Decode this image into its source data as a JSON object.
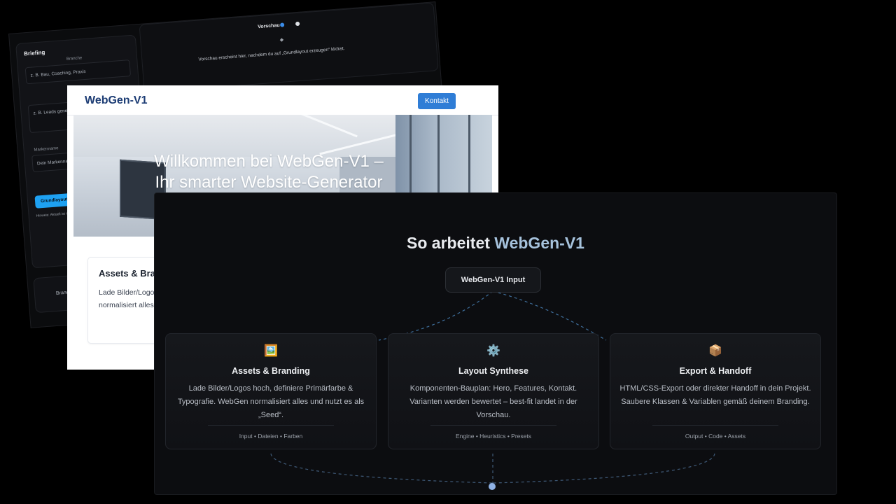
{
  "editor": {
    "briefing_title": "Briefing",
    "branche_label": "Branche",
    "branche_placeholder": "z. B. Bau, Coaching, Praxis",
    "goal_placeholder": "z. B. Leads generieren",
    "brand_label": "Markenname",
    "brand_placeholder": "Dein Markenname",
    "generate_button": "Grundlayout erz",
    "hint_text": "Hinweis: Aktuell ist m… wird funktionieren …",
    "branche_card": "Branche,",
    "preview_title": "Vorschau",
    "preview_text": "Vorschau erscheint hier, nachdem du auf „Grundlayout erzeugen“ klickst."
  },
  "site": {
    "logo": "WebGen-V1",
    "contact_button": "Kontakt",
    "hero_line1": "Willkommen bei WebGen-V1 –",
    "hero_line2": "Ihr smarter Website-Generator",
    "card_title": "Assets & Bran",
    "card_text": "Lade Bilder/Logos definiere Primarfa Typografie, WebG normalisiert alles"
  },
  "workflow": {
    "title_prefix": "So arbeitet ",
    "title_accent": "WebGen-V1",
    "input_label": "WebGen-V1 Input",
    "cards": [
      {
        "icon": "🖼️",
        "icon_name": "image-icon",
        "title": "Assets & Branding",
        "description": "Lade Bilder/Logos hoch, definiere Primärfarbe & Typografie. WebGen normalisiert alles und nutzt es als „Seed“.",
        "tags": "Input • Dateien • Farben"
      },
      {
        "icon": "⚙️",
        "icon_name": "gear-icon",
        "title": "Layout Synthese",
        "description": "Komponenten-Bauplan: Hero, Features, Kontakt. Varianten werden bewertet – best-fit landet in der Vorschau.",
        "tags": "Engine • Heuristics • Presets"
      },
      {
        "icon": "📦",
        "icon_name": "package-icon",
        "title": "Export & Handoff",
        "description": "HTML/CSS-Export oder direkter Handoff in dein Projekt. Saubere Klassen & Variablen gemäß deinem Branding.",
        "tags": "Output • Code • Assets"
      }
    ]
  },
  "colors": {
    "accent_blue": "#2f7dd6",
    "title_accent": "#a6c2dc",
    "dashed_line": "#3f6f9c",
    "generate_button": "#1ea1f2"
  }
}
